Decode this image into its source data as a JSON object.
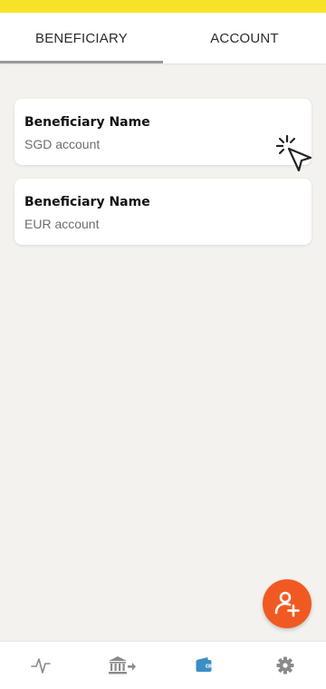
{
  "tabs": [
    {
      "label": "BENEFICIARY",
      "active": true
    },
    {
      "label": "ACCOUNT",
      "active": false
    }
  ],
  "beneficiaries": [
    {
      "name": "Beneficiary Name",
      "account": "SGD account"
    },
    {
      "name": "Beneficiary Name",
      "account": "EUR account"
    }
  ],
  "fab": {
    "icon": "add-user-icon",
    "color": "#f05a22"
  },
  "bottom_nav": [
    {
      "icon": "activity-icon",
      "active": false
    },
    {
      "icon": "bank-transfer-icon",
      "active": false
    },
    {
      "icon": "wallet-icon",
      "active": true
    },
    {
      "icon": "settings-gear-icon",
      "active": false
    }
  ],
  "colors": {
    "status_bar": "#f8e227",
    "background": "#f3f2ef",
    "active_nav": "#3d8ec6",
    "inactive_nav": "#8a8a8a"
  }
}
